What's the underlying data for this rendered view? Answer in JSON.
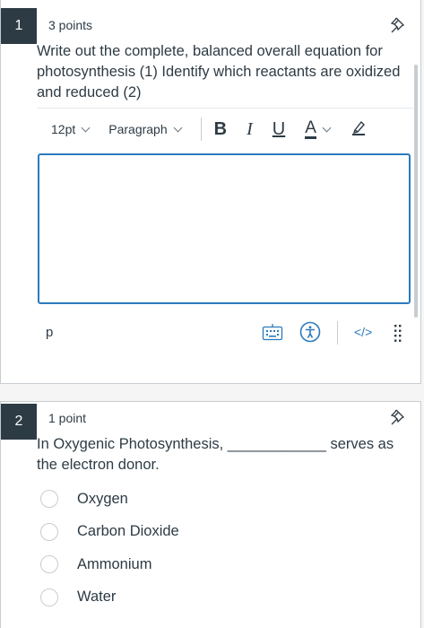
{
  "q1": {
    "number": "1",
    "points": "3 points",
    "text": "Write out the complete, balanced overall equation for photosynthesis (1) Identify which reactants are oxidized and reduced (2)",
    "toolbar": {
      "font_size": "12pt",
      "block_format": "Paragraph",
      "bold": "B",
      "italic": "I",
      "underline": "U",
      "text_color": "A"
    },
    "editor_value": "",
    "status_path": "p",
    "code_view": "</>"
  },
  "q2": {
    "number": "2",
    "points": "1 point",
    "text": "In Oxygenic Photosynthesis, ____________ serves as the electron donor.",
    "answers": [
      "Oxygen",
      "Carbon Dioxide",
      "Ammonium",
      "Water"
    ]
  },
  "colors": {
    "badge": "#2d3b45",
    "focus_border": "#2b7abc",
    "border": "#c7cdd1"
  },
  "icons": [
    "pin-icon",
    "keyboard-icon",
    "accessibility-icon",
    "code-view-icon",
    "drag-handle-icon",
    "highlighter-icon"
  ]
}
